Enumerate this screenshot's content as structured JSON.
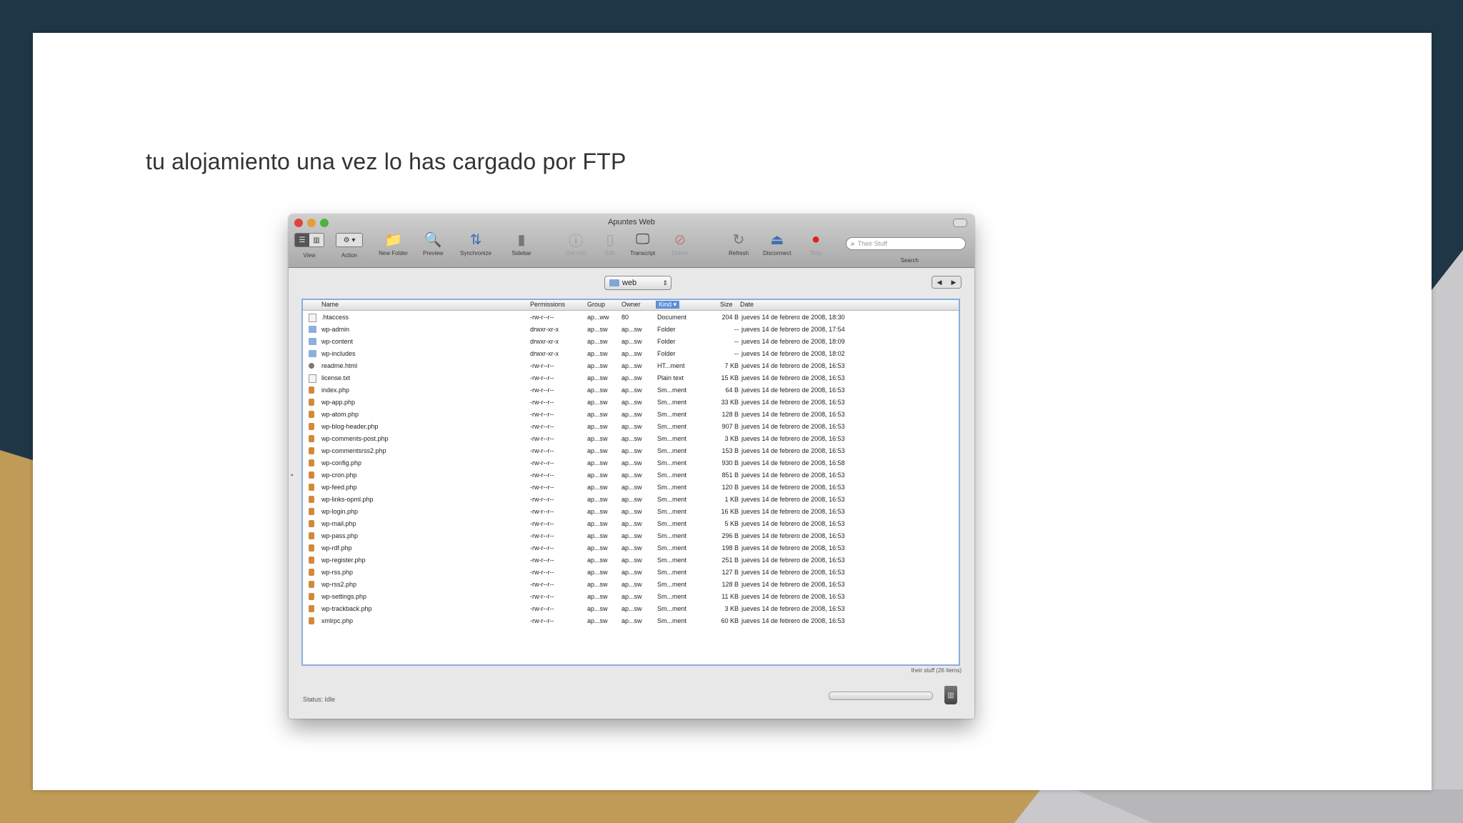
{
  "slide": {
    "text": "tu alojamiento una vez lo has cargado por FTP"
  },
  "window": {
    "title": "Apuntes Web",
    "traffic_lights": [
      "#e0443e",
      "#e2a034",
      "#4db33d"
    ],
    "toolbar": {
      "view": "View",
      "action": "Action",
      "new_folder": "New Folder",
      "preview": "Preview",
      "synchronize": "Synchronize",
      "sidebar": "Sidebar",
      "get_info": "Get Info",
      "edit": "Edit",
      "transcript": "Transcript",
      "delete": "Delete",
      "refresh": "Refresh",
      "disconnect": "Disconnect",
      "stop": "Stop",
      "search_placeholder": "Their Stuff",
      "search_label": "Search"
    },
    "path": "web",
    "columns": {
      "name": "Name",
      "permissions": "Permissions",
      "group": "Group",
      "owner": "Owner",
      "kind": "Kind",
      "size": "Size",
      "date": "Date"
    },
    "files": [
      {
        "name": ".htaccess",
        "icon": "doc-icon",
        "perm": "-rw-r--r--",
        "group": "ap...ww",
        "owner": "80",
        "kind": "Document",
        "size": "204 B",
        "date": "jueves 14 de febrero de 2008, 18:30"
      },
      {
        "name": "wp-admin",
        "icon": "folder-icon",
        "perm": "drwxr-xr-x",
        "group": "ap...sw",
        "owner": "ap...sw",
        "kind": "Folder",
        "size": "--",
        "date": "jueves 14 de febrero de 2008, 17:54"
      },
      {
        "name": "wp-content",
        "icon": "folder-icon",
        "perm": "drwxr-xr-x",
        "group": "ap...sw",
        "owner": "ap...sw",
        "kind": "Folder",
        "size": "--",
        "date": "jueves 14 de febrero de 2008, 18:09"
      },
      {
        "name": "wp-includes",
        "icon": "folder-icon",
        "perm": "drwxr-xr-x",
        "group": "ap...sw",
        "owner": "ap...sw",
        "kind": "Folder",
        "size": "--",
        "date": "jueves 14 de febrero de 2008, 18:02"
      },
      {
        "name": "readme.html",
        "icon": "html-icon",
        "perm": "-rw-r--r--",
        "group": "ap...sw",
        "owner": "ap...sw",
        "kind": "HT...ment",
        "size": "7 KB",
        "date": "jueves 14 de febrero de 2008, 16:53"
      },
      {
        "name": "license.txt",
        "icon": "doc-icon",
        "perm": "-rw-r--r--",
        "group": "ap...sw",
        "owner": "ap...sw",
        "kind": "Plain text",
        "size": "15 KB",
        "date": "jueves 14 de febrero de 2008, 16:53"
      },
      {
        "name": "index.php",
        "icon": "php-icon",
        "perm": "-rw-r--r--",
        "group": "ap...sw",
        "owner": "ap...sw",
        "kind": "Sm...ment",
        "size": "64 B",
        "date": "jueves 14 de febrero de 2008, 16:53"
      },
      {
        "name": "wp-app.php",
        "icon": "php-icon",
        "perm": "-rw-r--r--",
        "group": "ap...sw",
        "owner": "ap...sw",
        "kind": "Sm...ment",
        "size": "33 KB",
        "date": "jueves 14 de febrero de 2008, 16:53"
      },
      {
        "name": "wp-atom.php",
        "icon": "php-icon",
        "perm": "-rw-r--r--",
        "group": "ap...sw",
        "owner": "ap...sw",
        "kind": "Sm...ment",
        "size": "128 B",
        "date": "jueves 14 de febrero de 2008, 16:53"
      },
      {
        "name": "wp-blog-header.php",
        "icon": "php-icon",
        "perm": "-rw-r--r--",
        "group": "ap...sw",
        "owner": "ap...sw",
        "kind": "Sm...ment",
        "size": "907 B",
        "date": "jueves 14 de febrero de 2008, 16:53"
      },
      {
        "name": "wp-comments-post.php",
        "icon": "php-icon",
        "perm": "-rw-r--r--",
        "group": "ap...sw",
        "owner": "ap...sw",
        "kind": "Sm...ment",
        "size": "3 KB",
        "date": "jueves 14 de febrero de 2008, 16:53"
      },
      {
        "name": "wp-commentsrss2.php",
        "icon": "php-icon",
        "perm": "-rw-r--r--",
        "group": "ap...sw",
        "owner": "ap...sw",
        "kind": "Sm...ment",
        "size": "153 B",
        "date": "jueves 14 de febrero de 2008, 16:53"
      },
      {
        "name": "wp-config.php",
        "icon": "php-icon",
        "perm": "-rw-r--r--",
        "group": "ap...sw",
        "owner": "ap...sw",
        "kind": "Sm...ment",
        "size": "930 B",
        "date": "jueves 14 de febrero de 2008, 16:58"
      },
      {
        "name": "wp-cron.php",
        "icon": "php-icon",
        "perm": "-rw-r--r--",
        "group": "ap...sw",
        "owner": "ap...sw",
        "kind": "Sm...ment",
        "size": "851 B",
        "date": "jueves 14 de febrero de 2008, 16:53"
      },
      {
        "name": "wp-feed.php",
        "icon": "php-icon",
        "perm": "-rw-r--r--",
        "group": "ap...sw",
        "owner": "ap...sw",
        "kind": "Sm...ment",
        "size": "120 B",
        "date": "jueves 14 de febrero de 2008, 16:53"
      },
      {
        "name": "wp-links-opml.php",
        "icon": "php-icon",
        "perm": "-rw-r--r--",
        "group": "ap...sw",
        "owner": "ap...sw",
        "kind": "Sm...ment",
        "size": "1 KB",
        "date": "jueves 14 de febrero de 2008, 16:53"
      },
      {
        "name": "wp-login.php",
        "icon": "php-icon",
        "perm": "-rw-r--r--",
        "group": "ap...sw",
        "owner": "ap...sw",
        "kind": "Sm...ment",
        "size": "16 KB",
        "date": "jueves 14 de febrero de 2008, 16:53"
      },
      {
        "name": "wp-mail.php",
        "icon": "php-icon",
        "perm": "-rw-r--r--",
        "group": "ap...sw",
        "owner": "ap...sw",
        "kind": "Sm...ment",
        "size": "5 KB",
        "date": "jueves 14 de febrero de 2008, 16:53"
      },
      {
        "name": "wp-pass.php",
        "icon": "php-icon",
        "perm": "-rw-r--r--",
        "group": "ap...sw",
        "owner": "ap...sw",
        "kind": "Sm...ment",
        "size": "296 B",
        "date": "jueves 14 de febrero de 2008, 16:53"
      },
      {
        "name": "wp-rdf.php",
        "icon": "php-icon",
        "perm": "-rw-r--r--",
        "group": "ap...sw",
        "owner": "ap...sw",
        "kind": "Sm...ment",
        "size": "198 B",
        "date": "jueves 14 de febrero de 2008, 16:53"
      },
      {
        "name": "wp-register.php",
        "icon": "php-icon",
        "perm": "-rw-r--r--",
        "group": "ap...sw",
        "owner": "ap...sw",
        "kind": "Sm...ment",
        "size": "251 B",
        "date": "jueves 14 de febrero de 2008, 16:53"
      },
      {
        "name": "wp-rss.php",
        "icon": "php-icon",
        "perm": "-rw-r--r--",
        "group": "ap...sw",
        "owner": "ap...sw",
        "kind": "Sm...ment",
        "size": "127 B",
        "date": "jueves 14 de febrero de 2008, 16:53"
      },
      {
        "name": "wp-rss2.php",
        "icon": "php-icon",
        "perm": "-rw-r--r--",
        "group": "ap...sw",
        "owner": "ap...sw",
        "kind": "Sm...ment",
        "size": "128 B",
        "date": "jueves 14 de febrero de 2008, 16:53"
      },
      {
        "name": "wp-settings.php",
        "icon": "php-icon",
        "perm": "-rw-r--r--",
        "group": "ap...sw",
        "owner": "ap...sw",
        "kind": "Sm...ment",
        "size": "11 KB",
        "date": "jueves 14 de febrero de 2008, 16:53"
      },
      {
        "name": "wp-trackback.php",
        "icon": "php-icon",
        "perm": "-rw-r--r--",
        "group": "ap...sw",
        "owner": "ap...sw",
        "kind": "Sm...ment",
        "size": "3 KB",
        "date": "jueves 14 de febrero de 2008, 16:53"
      },
      {
        "name": "xmlrpc.php",
        "icon": "php-icon",
        "perm": "-rw-r--r--",
        "group": "ap...sw",
        "owner": "ap...sw",
        "kind": "Sm...ment",
        "size": "60 KB",
        "date": "jueves 14 de febrero de 2008, 16:53"
      }
    ],
    "item_count": "their stuff (26 items)",
    "status": "Status: Idle"
  }
}
